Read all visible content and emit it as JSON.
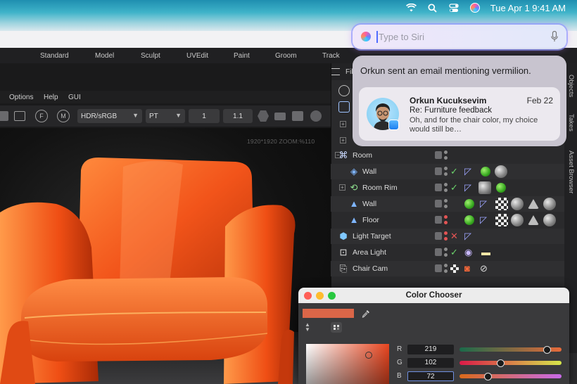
{
  "menubar": {
    "wifi_icon": "wifi-icon",
    "search_icon": "spotlight-search-icon",
    "control_center_icon": "control-center-icon",
    "siri_icon": "siri-icon",
    "datetime": "Tue Apr 1  9:41 AM"
  },
  "layout_tabs": [
    "Standard",
    "Model",
    "Sculpt",
    "UVEdit",
    "Paint",
    "Groom",
    "Track"
  ],
  "viewport": {
    "menu": [
      "Options",
      "Help",
      "GUI"
    ],
    "color_profile": "HDR/sRGB",
    "renderer": "PT",
    "field_a": "1",
    "field_b": "1.1",
    "zoom_readout": "1920*1920 ZOOM:%110"
  },
  "objects_panel": {
    "header_label": "Fil",
    "side_tabs": [
      "Objects",
      "Takes",
      "Asset Browser"
    ],
    "rows": [
      {
        "name": "Room"
      },
      {
        "name": "Wall"
      },
      {
        "name": "Room Rim"
      },
      {
        "name": "Wall"
      },
      {
        "name": "Floor"
      },
      {
        "name": "Light Target"
      },
      {
        "name": "Area Light"
      },
      {
        "name": "Chair Cam"
      }
    ]
  },
  "siri": {
    "placeholder": "Type to Siri"
  },
  "notification": {
    "summary": "Orkun sent an email mentioning vermilion.",
    "sender": "Orkun Kucuksevim",
    "date": "Feb 22",
    "subject": "Re: Furniture feedback",
    "preview": "Oh, and for the chair color, my choice would still be…"
  },
  "color_chooser": {
    "title": "Color Chooser",
    "swatch_color": "#DB6648",
    "channels": [
      {
        "label": "R",
        "value": "219",
        "fraction": 0.859
      },
      {
        "label": "G",
        "value": "102",
        "fraction": 0.4
      },
      {
        "label": "B",
        "value": "72",
        "fraction": 0.282
      }
    ]
  }
}
